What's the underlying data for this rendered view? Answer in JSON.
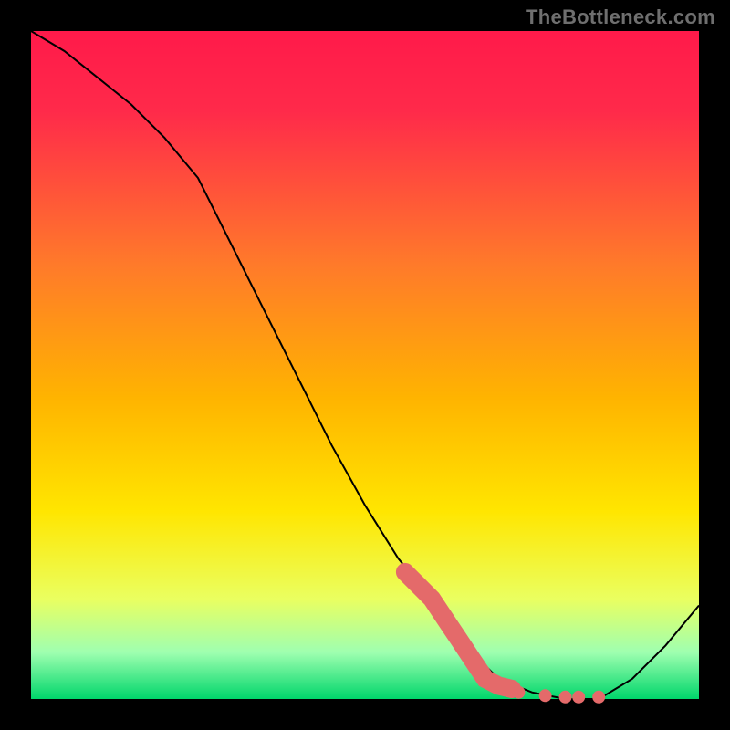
{
  "watermark": "TheBottleneck.com",
  "colors": {
    "background": "#000000",
    "gradient_top": "#ff1a4a",
    "gradient_mid": "#ffd400",
    "gradient_bottom": "#00d66b",
    "line": "#000000",
    "highlight": "#e46a6a",
    "watermark_text": "#6f6f6f"
  },
  "chart_data": {
    "type": "line",
    "title": "",
    "xlabel": "",
    "ylabel": "",
    "xlim": [
      0,
      100
    ],
    "ylim": [
      0,
      100
    ],
    "series": [
      {
        "name": "bottleneck-curve",
        "x": [
          0,
          5,
          10,
          15,
          20,
          25,
          30,
          35,
          40,
          45,
          50,
          55,
          60,
          65,
          70,
          75,
          80,
          85,
          90,
          95,
          100
        ],
        "values": [
          100,
          97,
          93,
          89,
          84,
          78,
          68,
          58,
          48,
          38,
          29,
          21,
          15,
          8,
          3,
          1,
          0,
          0,
          3,
          8,
          14
        ]
      }
    ],
    "highlight_segment": {
      "x": [
        56,
        58,
        60,
        62,
        64,
        66,
        68,
        70,
        72
      ],
      "values": [
        19,
        17,
        15,
        12,
        9,
        6,
        3,
        2,
        1.5
      ]
    },
    "highlight_dots": {
      "x": [
        73,
        77,
        80,
        82,
        85
      ],
      "values": [
        1,
        0.5,
        0.3,
        0.3,
        0.3
      ]
    }
  }
}
